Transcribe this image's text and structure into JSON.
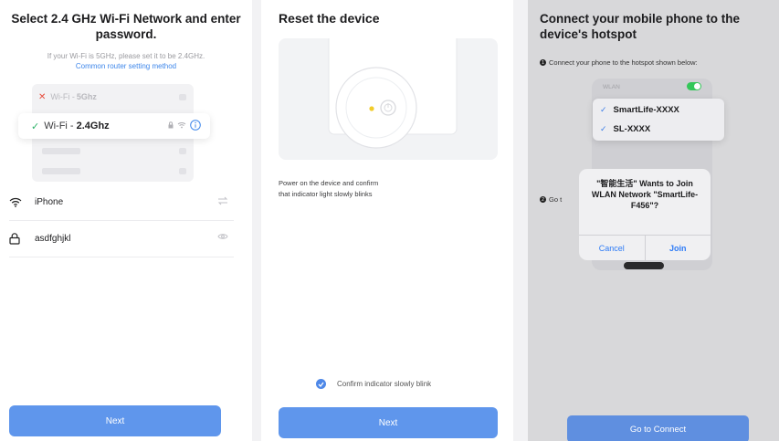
{
  "colors": {
    "accent": "#5f96ec",
    "link": "#3d86ea",
    "success": "#2fb36a",
    "error": "#e74c3c",
    "toggle_on": "#34c759"
  },
  "screen1": {
    "title": "Select 2.4 GHz Wi-Fi Network and enter password.",
    "hint": "If your Wi-Fi is 5GHz, please set it to be 2.4GHz.",
    "hint_link": "Common router setting method",
    "wifi_5g": {
      "prefix": "Wi-Fi - ",
      "band": "5Ghz"
    },
    "wifi_24g": {
      "prefix": "Wi-Fi - ",
      "band": "2.4Ghz"
    },
    "network_name": "iPhone",
    "password": "asdfghjkl",
    "next_label": "Next"
  },
  "screen2": {
    "title": "Reset the device",
    "description_line1": "Power on the device and confirm",
    "description_line2": "that indicator light slowly blinks",
    "confirm_label": "Confirm indicator slowly blink",
    "confirm_checked": true,
    "next_label": "Next"
  },
  "screen3": {
    "title": "Connect your mobile phone to the device's hotspot",
    "step1": "Connect your phone to the hotspot shown below:",
    "step2_partial": "Go t",
    "wlan_label": "WLAN",
    "wlan_on": true,
    "networks": [
      "SmartLife-XXXX",
      "SL-XXXX"
    ],
    "alert_message": "\"智能生活\" Wants to Join WLAN Network \"SmartLife-F456\"?",
    "alert_cancel": "Cancel",
    "alert_join": "Join",
    "go_label": "Go to Connect"
  }
}
